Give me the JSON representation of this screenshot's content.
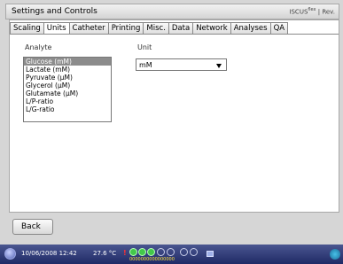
{
  "window": {
    "title": "Settings and Controls",
    "brand": "ISCUS",
    "brand_sup": "flex",
    "brand_suffix": "| Rev."
  },
  "tabs": [
    {
      "label": "Scaling",
      "active": false
    },
    {
      "label": "Units",
      "active": true
    },
    {
      "label": "Catheter",
      "active": false
    },
    {
      "label": "Printing",
      "active": false
    },
    {
      "label": "Misc.",
      "active": false
    },
    {
      "label": "Data",
      "active": false
    },
    {
      "label": "Network",
      "active": false
    },
    {
      "label": "Analyses",
      "active": false
    },
    {
      "label": "QA",
      "active": false
    }
  ],
  "units_tab": {
    "analyte_label": "Analyte",
    "unit_label": "Unit",
    "analytes": [
      {
        "label": "Glucose (mM)",
        "selected": true
      },
      {
        "label": "Lactate (mM)",
        "selected": false
      },
      {
        "label": "Pyruvate (µM)",
        "selected": false
      },
      {
        "label": "Glycerol (µM)",
        "selected": false
      },
      {
        "label": "Glutamate (µM)",
        "selected": false
      },
      {
        "label": "L/P-ratio",
        "selected": false
      },
      {
        "label": "L/G-ratio",
        "selected": false
      }
    ],
    "unit_value": "mM"
  },
  "footer": {
    "back_label": "Back"
  },
  "taskbar": {
    "datetime": "10/06/2008 12:42",
    "temperature": "27.6 °C",
    "warning": "!",
    "status_lights": [
      "on",
      "on",
      "on",
      "off",
      "off",
      "off",
      "off"
    ],
    "status_digits": "0000000000000000"
  },
  "colors": {
    "selection": "#8c8c8c",
    "taskbar": "#2a3576",
    "status_on": "#43c84a",
    "warning": "#ff3030"
  }
}
